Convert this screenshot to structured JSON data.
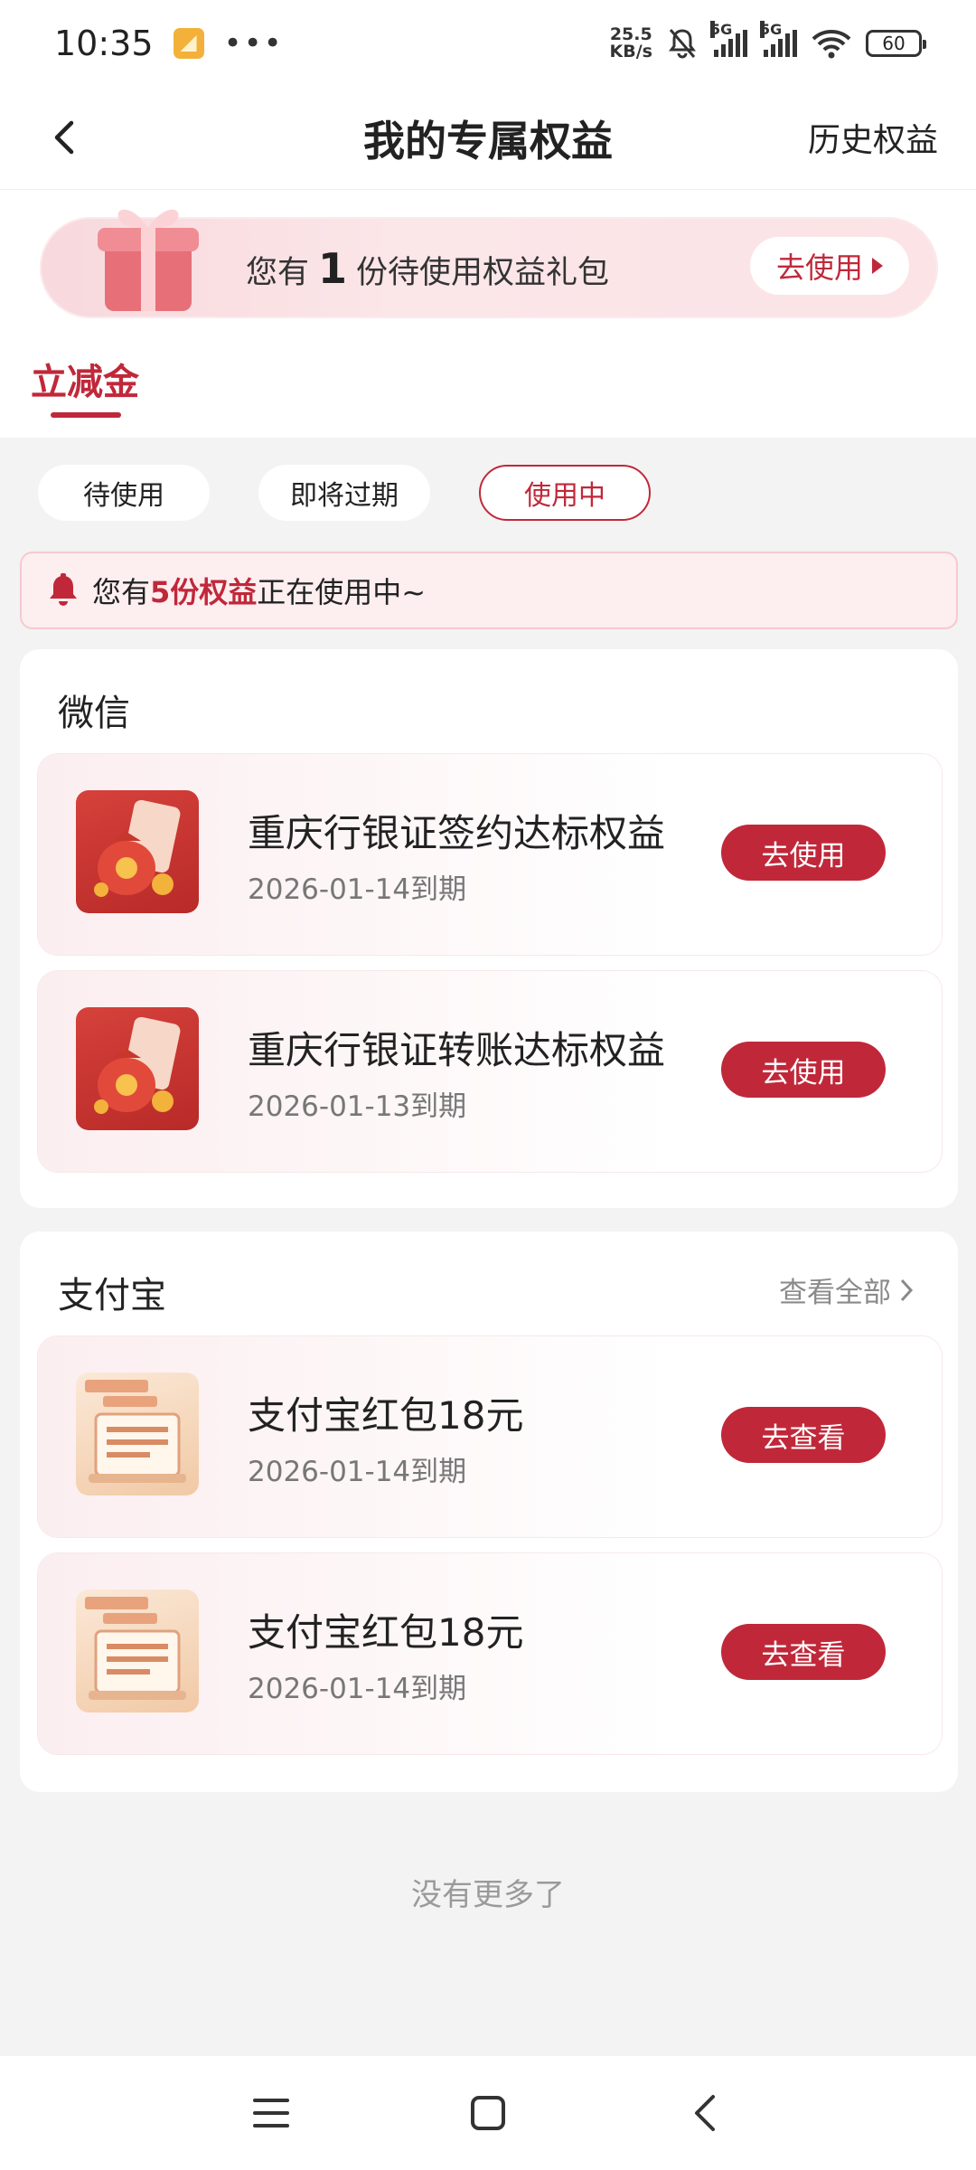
{
  "status_bar": {
    "time": "10:35",
    "dots": "•••",
    "net_speed_value": "25.5",
    "net_speed_unit": "KB/s",
    "sig1": "5G",
    "sig2": "5G",
    "battery": "60"
  },
  "header": {
    "title": "我的专属权益",
    "right_link": "历史权益"
  },
  "gift_banner": {
    "prefix": "您有",
    "count": "1",
    "suffix": "份待使用权益礼包",
    "button": "去使用"
  },
  "tab": {
    "label": "立减金"
  },
  "filters": {
    "items": [
      "待使用",
      "即将过期",
      "使用中"
    ],
    "active": "使用中"
  },
  "notice": {
    "prefix": "您有",
    "highlight": "5份权益",
    "suffix": "正在使用中~"
  },
  "sections": [
    {
      "title": "微信",
      "view_all": "",
      "items": [
        {
          "title": "重庆行银证签约达标权益",
          "date": "2026-01-14到期",
          "button": "去使用"
        },
        {
          "title": "重庆行银证转账达标权益",
          "date": "2026-01-13到期",
          "button": "去使用"
        }
      ]
    },
    {
      "title": "支付宝",
      "view_all": "查看全部",
      "items": [
        {
          "title": "支付宝红包18元",
          "date": "2026-01-14到期",
          "button": "去查看"
        },
        {
          "title": "支付宝红包18元",
          "date": "2026-01-14到期",
          "button": "去查看"
        }
      ]
    }
  ],
  "footer_text": "没有更多了",
  "colors": {
    "accent": "#c0283a",
    "background": "#f3f3f3",
    "notice_bg": "#fdeef0"
  }
}
